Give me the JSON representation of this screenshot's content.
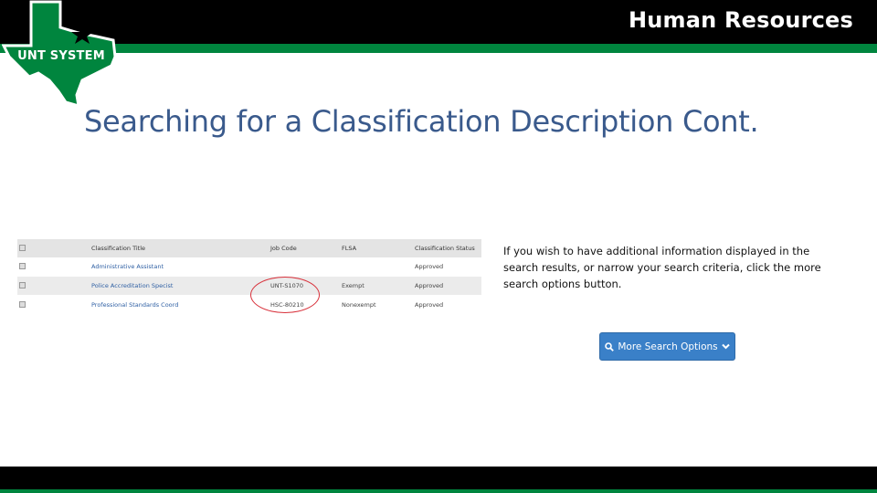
{
  "header": {
    "title": "Human Resources",
    "logo_text": "UNT SYSTEM"
  },
  "slide": {
    "title": "Searching for a Classification Description Cont.",
    "description": "If you wish to have additional information displayed in the search results, or narrow your search criteria, click the more search options button."
  },
  "table": {
    "columns": [
      "Classification Title",
      "Job Code",
      "FLSA",
      "Classification Status"
    ],
    "rows": [
      {
        "title": "Administrative Assistant",
        "job_code": "",
        "flsa": "",
        "status": "Approved"
      },
      {
        "title": "Police Accreditation Specist",
        "job_code": "UNT-S1070",
        "flsa": "Exempt",
        "status": "Approved"
      },
      {
        "title": "Professional Standards Coord",
        "job_code": "HSC-80210",
        "flsa": "Nonexempt",
        "status": "Approved"
      }
    ]
  },
  "button": {
    "label": "More Search Options"
  },
  "colors": {
    "brand_green": "#00853e",
    "title_blue": "#3a5a8c",
    "button_blue": "#3a80c8",
    "highlight_red": "#d8303a"
  }
}
